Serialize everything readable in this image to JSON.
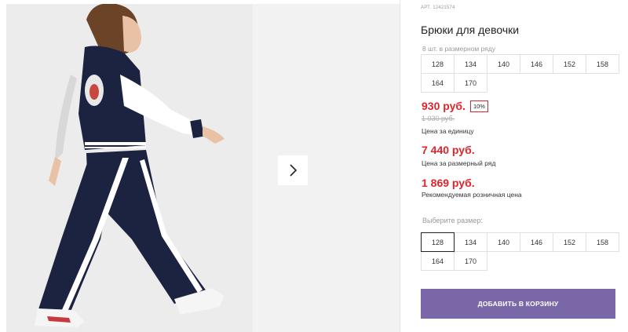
{
  "product": {
    "sku_label": "АРТ.",
    "sku_value": "12421574",
    "title": "Брюки для девочки"
  },
  "pack": {
    "note": "8 шт. в размерном ряду",
    "sizes": [
      "128",
      "134",
      "140",
      "146",
      "152",
      "158",
      "164",
      "170"
    ]
  },
  "pricing": {
    "unit_price": "930 руб.",
    "discount": "10%",
    "old_price": "1 030 руб.",
    "unit_caption": "Цена за единицу",
    "pack_price": "7 440 руб.",
    "pack_caption": "Цена за размерный ряд",
    "retail_price": "1 869 руб.",
    "retail_caption": "Рекомендуемая розничная цена"
  },
  "size_select": {
    "label": "Выберите размер:",
    "sizes": [
      "128",
      "134",
      "140",
      "146",
      "152",
      "158",
      "164",
      "170"
    ],
    "selected": "128"
  },
  "cart": {
    "add_label": "ДОБАВИТЬ В КОРЗИНУ"
  },
  "colors": {
    "accent": "#7a67a8",
    "price": "#e2232a",
    "navy": "#1b2340"
  },
  "icons": {
    "next": "chevron-right-icon"
  }
}
